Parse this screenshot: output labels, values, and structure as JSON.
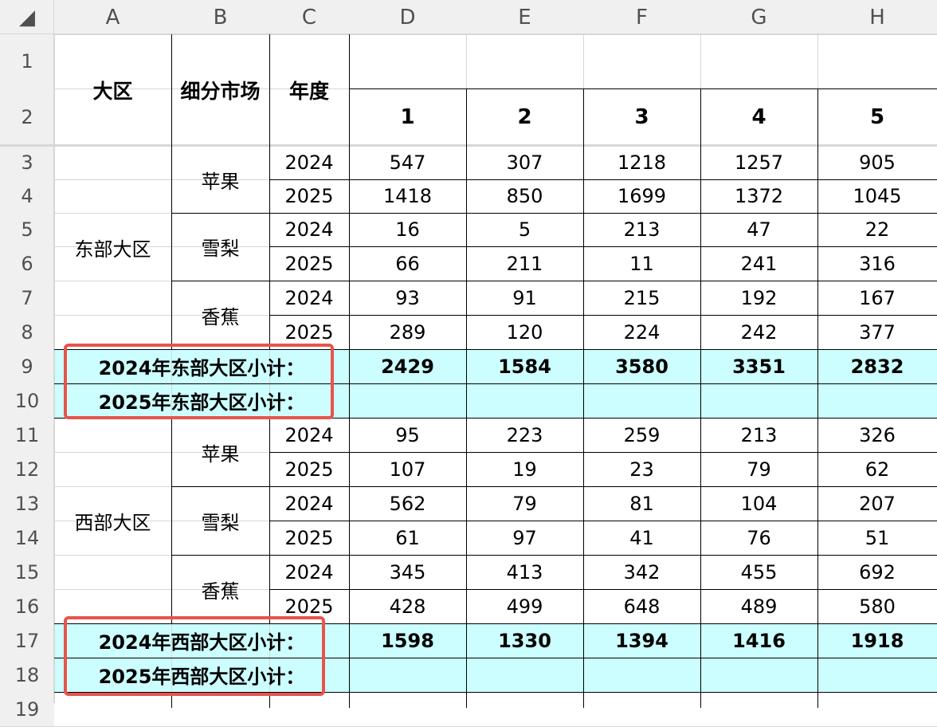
{
  "sheet": {
    "select_all_glyph": "◢",
    "columns": [
      "A",
      "B",
      "C",
      "D",
      "E",
      "F",
      "G",
      "H"
    ],
    "rows": [
      "1",
      "2",
      "3",
      "4",
      "5",
      "6",
      "7",
      "8",
      "9",
      "10",
      "11",
      "12",
      "13",
      "14",
      "15",
      "16",
      "17",
      "18",
      "19"
    ]
  },
  "headers": {
    "region": "大区",
    "segment": "细分市场",
    "year": "年度",
    "numbers": [
      "1",
      "2",
      "3",
      "4",
      "5"
    ]
  },
  "groups": [
    {
      "region": "东部大区",
      "markets": [
        {
          "name": "苹果",
          "rows": [
            {
              "year": "2024",
              "values": [
                "547",
                "307",
                "1218",
                "1257",
                "905"
              ]
            },
            {
              "year": "2025",
              "values": [
                "1418",
                "850",
                "1699",
                "1372",
                "1045"
              ]
            }
          ]
        },
        {
          "name": "雪梨",
          "rows": [
            {
              "year": "2024",
              "values": [
                "16",
                "5",
                "213",
                "47",
                "22"
              ]
            },
            {
              "year": "2025",
              "values": [
                "66",
                "211",
                "11",
                "241",
                "316"
              ]
            }
          ]
        },
        {
          "name": "香蕉",
          "rows": [
            {
              "year": "2024",
              "values": [
                "93",
                "91",
                "215",
                "192",
                "167"
              ]
            },
            {
              "year": "2025",
              "values": [
                "289",
                "120",
                "224",
                "242",
                "377"
              ]
            }
          ]
        }
      ],
      "subtotals": [
        {
          "label": "2024年东部大区小计：",
          "values": [
            "2429",
            "1584",
            "3580",
            "3351",
            "2832"
          ]
        },
        {
          "label": "2025年东部大区小计：",
          "values": [
            "",
            "",
            "",
            "",
            ""
          ]
        }
      ]
    },
    {
      "region": "西部大区",
      "markets": [
        {
          "name": "苹果",
          "rows": [
            {
              "year": "2024",
              "values": [
                "95",
                "223",
                "259",
                "213",
                "326"
              ]
            },
            {
              "year": "2025",
              "values": [
                "107",
                "19",
                "23",
                "79",
                "62"
              ]
            }
          ]
        },
        {
          "name": "雪梨",
          "rows": [
            {
              "year": "2024",
              "values": [
                "562",
                "79",
                "81",
                "104",
                "207"
              ]
            },
            {
              "year": "2025",
              "values": [
                "61",
                "97",
                "41",
                "76",
                "51"
              ]
            }
          ]
        },
        {
          "name": "香蕉",
          "rows": [
            {
              "year": "2024",
              "values": [
                "345",
                "413",
                "342",
                "455",
                "692"
              ]
            },
            {
              "year": "2025",
              "values": [
                "428",
                "499",
                "648",
                "489",
                "580"
              ]
            }
          ]
        }
      ],
      "subtotals": [
        {
          "label": "2024年西部大区小计：",
          "values": [
            "1598",
            "1330",
            "1394",
            "1416",
            "1918"
          ]
        },
        {
          "label": "2025年西部大区小计：",
          "values": [
            "",
            "",
            "",
            "",
            ""
          ]
        }
      ]
    }
  ],
  "colors": {
    "subtotal_fill": "#ccfeff",
    "highlight_border": "#e8544a",
    "header_fill": "#f0f0f0"
  }
}
